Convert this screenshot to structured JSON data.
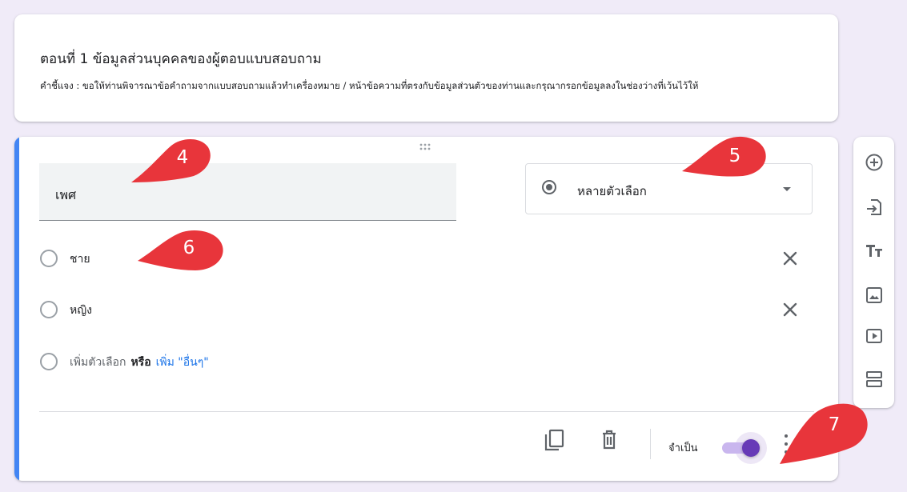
{
  "section": {
    "title": "ตอนที่ 1 ข้อมูลส่วนบุคคลของผู้ตอบแบบสอบถาม",
    "description": "คำชี้แจง : ขอให้ท่านพิจารณาข้อคำถามจากแบบสอบถามแล้วทำเครื่องหมาย / หน้าข้อความที่ตรงกับข้อมูลส่วนตัวของท่านและกรุณากรอกข้อมูลลงในช่องว่างที่เว้นไว้ให้"
  },
  "question": {
    "title": "เพศ",
    "type_label": "หลายตัวเลือก",
    "options": [
      {
        "label": "ชาย"
      },
      {
        "label": "หญิง"
      }
    ],
    "add_option_label": "เพิ่มตัวเลือก",
    "or_label": "หรือ",
    "add_other_label": "เพิ่ม \"อื่นๆ\"",
    "required_label": "จำเป็น",
    "required_on": true
  },
  "callouts": {
    "c4": "4",
    "c5": "5",
    "c6": "6",
    "c7": "7"
  },
  "colors": {
    "accent": "#673ab7",
    "active_bar": "#4285f4",
    "link": "#1a73e8",
    "callout": "#e8353b",
    "background": "#f0ebf8"
  },
  "icons": {
    "toolbar": [
      "add-question-icon",
      "import-questions-icon",
      "add-title-icon",
      "add-image-icon",
      "add-video-icon",
      "add-section-icon"
    ],
    "footer": [
      "duplicate-icon",
      "delete-icon",
      "more-vert-icon"
    ],
    "option": [
      "radio-icon",
      "close-icon"
    ]
  }
}
